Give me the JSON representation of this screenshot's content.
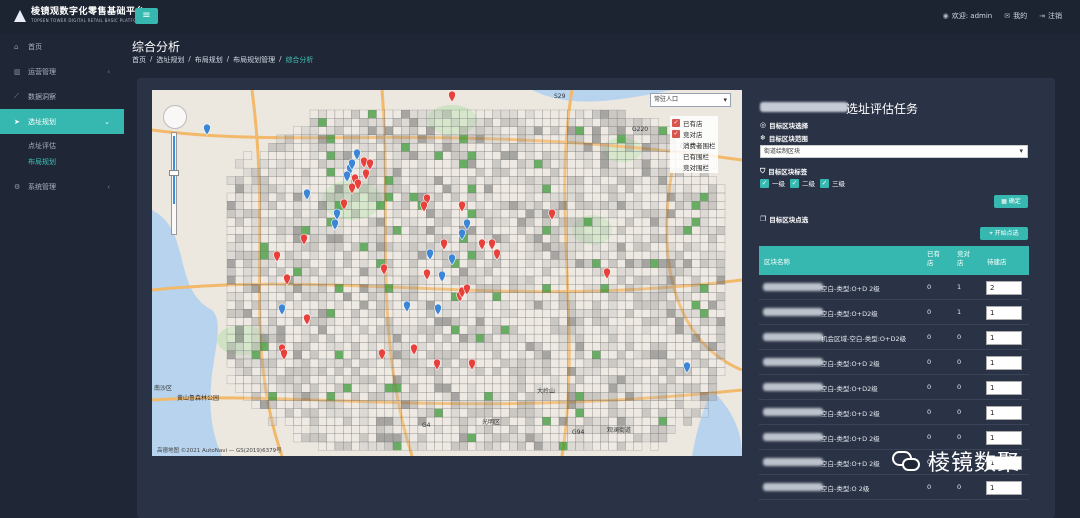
{
  "header": {
    "logo_title": "棱镜观数字化零售基础平台",
    "logo_subtitle": "TOPSEN TOWER DIGITAL RETAIL BASIC PLATFORM",
    "menu_icon": "hamburger-icon",
    "welcome": "欢迎: admin",
    "mine": "我的",
    "logout": "注销"
  },
  "sidebar": {
    "items": [
      {
        "label": "首页",
        "icon": "home-icon"
      },
      {
        "label": "运营管理",
        "icon": "bar-chart-icon"
      },
      {
        "label": "数据洞察",
        "icon": "line-chart-icon"
      },
      {
        "label": "选址规划",
        "icon": "location-arrow-icon"
      },
      {
        "label": "系统管理",
        "icon": "gear-icon"
      }
    ],
    "subitems": [
      "点址评估",
      "布局规划"
    ]
  },
  "page": {
    "title": "综合分析",
    "breadcrumb": [
      "首页",
      "选址规划",
      "布局规划",
      "布局规划管理",
      "综合分析"
    ]
  },
  "map": {
    "layer_select": "常驻人口",
    "legend": [
      {
        "label": "已有店",
        "checked": true
      },
      {
        "label": "竞对店",
        "checked": true
      },
      {
        "label": "消费者围栏",
        "checked": false
      },
      {
        "label": "已有围栏",
        "checked": false
      },
      {
        "label": "竞对围栏",
        "checked": false
      }
    ],
    "copyright": "高德地图 ©2021 AutoNavi — GS(2019)6379号",
    "labels": [
      "南沙区",
      "黄山鲁森林公园",
      "光明区",
      "观澜街道",
      "大岭山",
      "S29",
      "G220",
      "G0422",
      "G4",
      "G94"
    ],
    "marker_colors": {
      "own": "#e8413c",
      "competitor": "#3b86d6",
      "heat_high": "#3c9a3a",
      "heat_mid": "#8a8a8a"
    }
  },
  "task": {
    "title": "选址评估任务",
    "block_select_label": "目标区块选择",
    "block_range_label": "目标区块范围",
    "range_value": "街道绘制区块",
    "block_tag_label": "目标区块标签",
    "tags": [
      "一级",
      "二级",
      "三级"
    ],
    "confirm_button": "确定",
    "block_pick_label": "目标区块点选",
    "start_button": "开始点选",
    "table": {
      "headers": [
        "区块名称",
        "已有店",
        "竞对店",
        "待建店"
      ],
      "rows": [
        {
          "name": "空白-类型:O+D 2级",
          "own": "0",
          "comp": "1",
          "plan": "2"
        },
        {
          "name": "空白-类型:O+D2级",
          "own": "0",
          "comp": "1",
          "plan": "1"
        },
        {
          "name": "机会区域-空白-类型:O+D2级",
          "own": "0",
          "comp": "0",
          "plan": "1"
        },
        {
          "name": "空白-类型:O+D 2级",
          "own": "0",
          "comp": "0",
          "plan": "1"
        },
        {
          "name": "空白-类型:O+D2级",
          "own": "0",
          "comp": "0",
          "plan": "1"
        },
        {
          "name": "空白-类型:O+D 2级",
          "own": "0",
          "comp": "0",
          "plan": "1"
        },
        {
          "name": "空白-类型:O+D 2级",
          "own": "0",
          "comp": "0",
          "plan": "1"
        },
        {
          "name": "空白-类型:O+D 2级",
          "own": "0",
          "comp": "0",
          "plan": "1"
        },
        {
          "name": "空白-类型:O 2级",
          "own": "0",
          "comp": "0",
          "plan": "1"
        }
      ]
    }
  },
  "watermark": "棱镜数聚"
}
